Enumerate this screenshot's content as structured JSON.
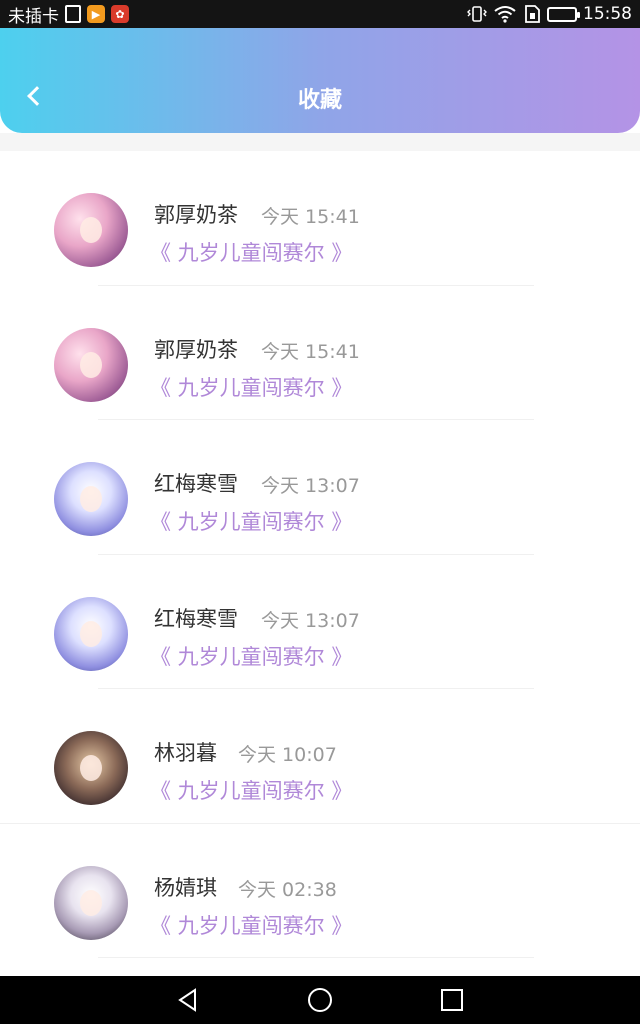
{
  "status_bar": {
    "carrier": "未插卡",
    "time": "15:58",
    "icons": [
      "sim-icon",
      "video-app-icon",
      "huawei-app-icon",
      "vibrate-icon",
      "wifi-icon",
      "sim-card-icon",
      "battery-icon"
    ]
  },
  "header": {
    "title": "收藏",
    "back_icon": "chevron-left-icon"
  },
  "colors": {
    "header_gradient_start": "#4dd0ee",
    "header_gradient_end": "#b493e6",
    "book_title": "#b088d8",
    "name": "#333333",
    "time": "#999999"
  },
  "favorites": [
    {
      "name": "郭厚奶茶",
      "time": "今天 15:41",
      "book": "《 九岁儿童闯赛尔 》"
    },
    {
      "name": "郭厚奶茶",
      "time": "今天 15:41",
      "book": "《 九岁儿童闯赛尔 》"
    },
    {
      "name": "红梅寒雪",
      "time": "今天 13:07",
      "book": "《 九岁儿童闯赛尔 》"
    },
    {
      "name": "红梅寒雪",
      "time": "今天 13:07",
      "book": "《 九岁儿童闯赛尔 》"
    },
    {
      "name": "林羽暮",
      "time": "今天 10:07",
      "book": "《 九岁儿童闯赛尔 》"
    },
    {
      "name": "杨婧琪",
      "time": "今天 02:38",
      "book": "《 九岁儿童闯赛尔 》"
    }
  ],
  "nav_bar": {
    "buttons": [
      "back-triangle-icon",
      "home-circle-icon",
      "recent-square-icon"
    ]
  }
}
